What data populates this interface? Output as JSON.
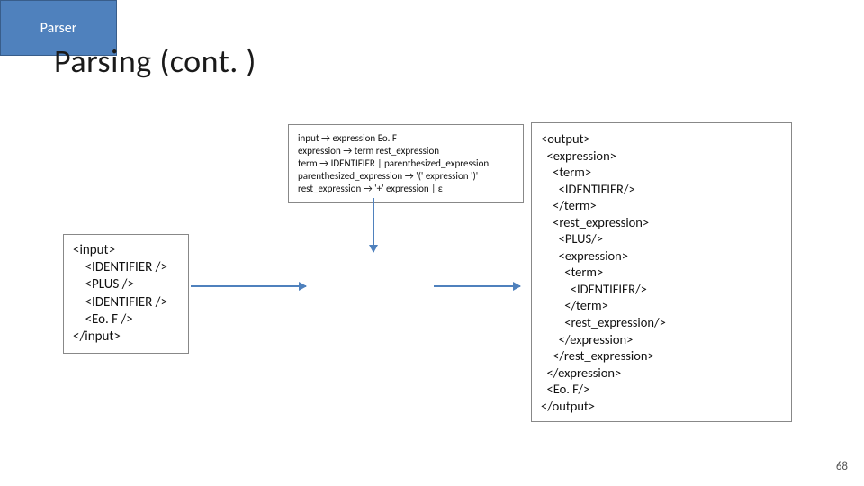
{
  "title": "Parsing (cont. )",
  "grammar": "input → expression Eo. F\nexpression → term rest_expression\nterm → IDENTIFIER | parenthesized_expression\nparenthesized_expression → '(' expression ')'\nrest_expression → '+' expression | ε",
  "input_source": "<input>\n    <IDENTIFIER />\n    <PLUS />\n    <IDENTIFIER />\n    <Eo. F />\n</input>",
  "parser_label": "Parser",
  "output_tree": "<output>\n  <expression>\n    <term>\n      <IDENTIFIER/>\n    </term>\n    <rest_expression>\n      <PLUS/>\n      <expression>\n        <term>\n          <IDENTIFIER/>\n        </term>\n        <rest_expression/>\n      </expression>\n    </rest_expression>\n  </expression>\n  <Eo. F/>\n</output>",
  "page_number": "68"
}
